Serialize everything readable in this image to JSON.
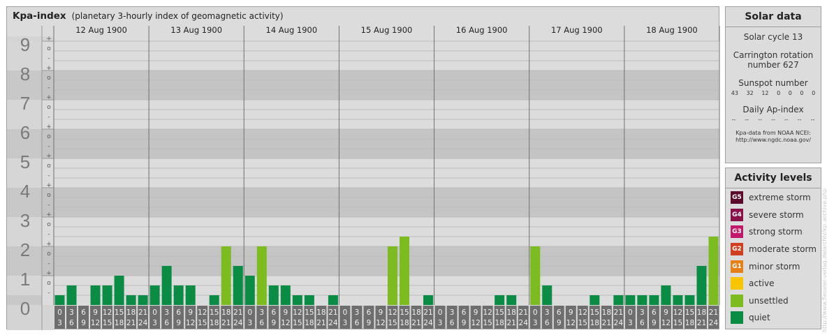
{
  "header": {
    "title": "Kpa-index",
    "subtitle": "(planetary 3-hourly index of geomagnetic activity)"
  },
  "chart_data": {
    "type": "bar",
    "title": "Kpa-index",
    "subtitle": "(planetary 3-hourly index of geomagnetic activity)",
    "ylim": [
      0,
      9
    ],
    "y_ticks": [
      "0",
      "1",
      "2",
      "3",
      "4",
      "5",
      "6",
      "7",
      "8",
      "9"
    ],
    "minor_ticks": [
      "-",
      "o",
      "+"
    ],
    "days": [
      "12 Aug 1900",
      "13 Aug 1900",
      "14 Aug 1900",
      "15 Aug 1900",
      "16 Aug 1900",
      "17 Aug 1900",
      "18 Aug 1900"
    ],
    "interval_top": [
      "0",
      "3",
      "6",
      "9",
      "12",
      "15",
      "18",
      "21"
    ],
    "interval_bottom": [
      "3",
      "6",
      "9",
      "12",
      "15",
      "18",
      "21",
      "24"
    ],
    "values": [
      [
        0.333,
        0.667,
        0,
        0.667,
        0.667,
        1,
        0.333,
        0.333
      ],
      [
        0.667,
        1.333,
        0.667,
        0.667,
        0,
        0.333,
        2,
        1.333
      ],
      [
        1,
        2,
        0.667,
        0.667,
        0.333,
        0.333,
        0,
        0.333
      ],
      [
        0,
        0,
        0,
        0,
        2,
        2.333,
        0,
        0.333
      ],
      [
        0,
        0,
        0,
        0,
        0,
        0.333,
        0.333,
        0
      ],
      [
        2,
        0.667,
        0,
        0,
        0,
        0.333,
        0,
        0.333
      ],
      [
        0.333,
        0.333,
        0.333,
        0.667,
        0.333,
        0.333,
        1.333,
        2.333
      ]
    ],
    "bar_colors": {
      "quiet": "#0a8c44",
      "unsettled": "#7dbc20",
      "active": "#f7c600"
    }
  },
  "solar": {
    "title": "Solar data",
    "cycle": "Solar cycle 13",
    "carrington_1": "Carrington rotation",
    "carrington_2": "number 627",
    "sunspot_label": "Sunspot number",
    "sunspots": [
      "43",
      "32",
      "12",
      "0",
      "0",
      "0",
      "0"
    ],
    "ap_label": "Daily Ap-index",
    "ap": [
      "--",
      "--",
      "--",
      "--",
      "--",
      "--",
      "--"
    ],
    "credit_1": "Kpa-data from NOAA NCEI:",
    "credit_2": "http://www.ngdc.noaa.gov/"
  },
  "activity": {
    "title": "Activity levels",
    "levels": [
      {
        "code": "G5",
        "label": "extreme storm",
        "color": "#5a0a2a"
      },
      {
        "code": "G4",
        "label": "severe storm",
        "color": "#8a1048"
      },
      {
        "code": "G3",
        "label": "strong storm",
        "color": "#c0186a"
      },
      {
        "code": "G2",
        "label": "moderate storm",
        "color": "#d04020"
      },
      {
        "code": "G1",
        "label": "minor storm",
        "color": "#e8801a"
      },
      {
        "code": "",
        "label": "active",
        "color": "#f7c600"
      },
      {
        "code": "",
        "label": "unsettled",
        "color": "#7dbc20"
      },
      {
        "code": "",
        "label": "quiet",
        "color": "#0a8c44"
      }
    ]
  },
  "watermark": "http://www.fieseler-verlag.de/archiv/kp_archive.php"
}
